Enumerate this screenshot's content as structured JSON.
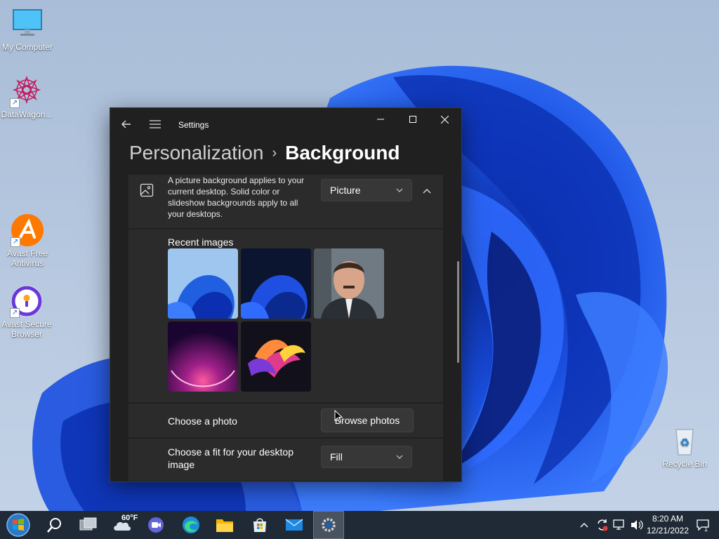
{
  "desktop": {
    "icons": [
      {
        "label": "My Computer"
      },
      {
        "label": "DataWagon..."
      },
      {
        "label": "Avast Free Antivirus"
      },
      {
        "label": "Avast Secure Browser"
      },
      {
        "label": "Recycle Bin"
      }
    ]
  },
  "window": {
    "title": "Settings",
    "breadcrumb_parent": "Personalization",
    "breadcrumb_separator": "›",
    "breadcrumb_current": "Background",
    "background_description": "A picture background applies to your current desktop. Solid color or slideshow backgrounds apply to all your desktops.",
    "background_type": "Picture",
    "recent_images_label": "Recent images",
    "recent_images": [
      "bloom-light",
      "bloom-dark",
      "portrait",
      "purple-glow",
      "colorful-ribbon"
    ],
    "choose_photo_label": "Choose a photo",
    "browse_button": "Browse photos",
    "fit_label": "Choose a fit for your desktop image",
    "fit_value": "Fill"
  },
  "taskbar": {
    "weather_temp": "60°F",
    "time": "8:20 AM",
    "date": "12/21/2022",
    "notification_count": "1"
  },
  "colors": {
    "window_bg": "#202020",
    "card_bg": "#2b2b2b",
    "taskbar_bg": "#1f2a36"
  }
}
